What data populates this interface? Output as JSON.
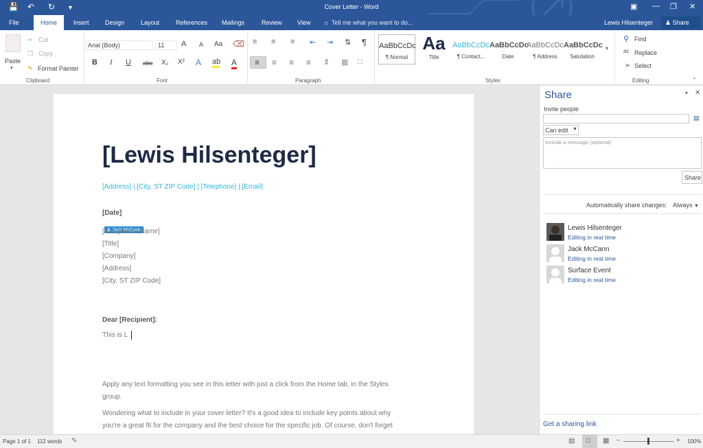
{
  "app": {
    "title": "Cover Letter - Word"
  },
  "tabs": [
    "File",
    "Home",
    "Insert",
    "Design",
    "Layout",
    "References",
    "Mailings",
    "Review",
    "View"
  ],
  "tell_me": "Tell me what you want to do...",
  "user": {
    "name": "Lewis Hilsenteger",
    "share_label": "Share"
  },
  "clipboard": {
    "paste": "Paste",
    "cut": "Cut",
    "copy": "Copy",
    "format_painter": "Format Painter",
    "label": "Clipboard"
  },
  "font": {
    "name": "Arial (Body)",
    "size": "11",
    "label": "Font",
    "bold": "B",
    "italic": "I",
    "underline": "U",
    "strike": "abc",
    "sub": "X₂",
    "sup": "X²",
    "case": "Aa",
    "grow": "A",
    "shrink": "A"
  },
  "paragraph": {
    "label": "Paragraph",
    "pilcrow": "¶"
  },
  "styles": {
    "label": "Styles",
    "items": [
      {
        "preview": "AaBbCcDc",
        "name": "¶ Normal"
      },
      {
        "preview": "Aa",
        "name": "Title"
      },
      {
        "preview": "AaBbCcDc",
        "name": "¶ Contact..."
      },
      {
        "preview": "AaBbCcDc",
        "name": "Date"
      },
      {
        "preview": "AaBbCcDc",
        "name": "¶ Address"
      },
      {
        "preview": "AaBbCcDc",
        "name": "Salutation"
      }
    ]
  },
  "editing": {
    "find": "Find",
    "replace": "Replace",
    "select": "Select",
    "label": "Editing"
  },
  "document": {
    "name": "[Lewis Hilsenteger]",
    "contact": "[Address] | [City, ST ZIP Code] | [Telephone] | [Email]",
    "date": "[Date]",
    "coauthor_tag": "Jack McCann",
    "recipient_lines": [
      "[Recipient's Name]",
      "[Title]",
      "[Company]",
      "[Address]",
      "[City, ST ZIP Code]"
    ],
    "salutation": "Dear [Recipient]:",
    "typed": "This is L",
    "para1_a": "Apply any text formatting you see in this letter with just a click from the Home tab, in the Styles",
    "para1_b": "group.",
    "para2_a": "Wondering what to include in your cover letter? It's a good idea to include key points about why",
    "para2_b": "you're a great fit for the company and the best choice for the specific job. Of course, don't forget"
  },
  "share_pane": {
    "title": "Share",
    "invite_label": "Invite people",
    "permission": "Can edit",
    "message_placeholder": "Include a message (optional)",
    "share_button": "Share",
    "auto_share_label": "Automatically share changes:",
    "auto_share_value": "Always",
    "people": [
      {
        "name": "Lewis Hilsenteger",
        "status": "Editing in real time"
      },
      {
        "name": "Jack McCann",
        "status": "Editing in real time"
      },
      {
        "name": "Surface Event",
        "status": "Editing in real time"
      }
    ],
    "link": "Get a sharing link"
  },
  "status": {
    "page": "Page 1 of 1",
    "words": "112 words",
    "zoom": "100%"
  },
  "colors": {
    "accent": "#2b579a",
    "contact_text": "#33b6d8",
    "heading": "#1f2a44"
  }
}
